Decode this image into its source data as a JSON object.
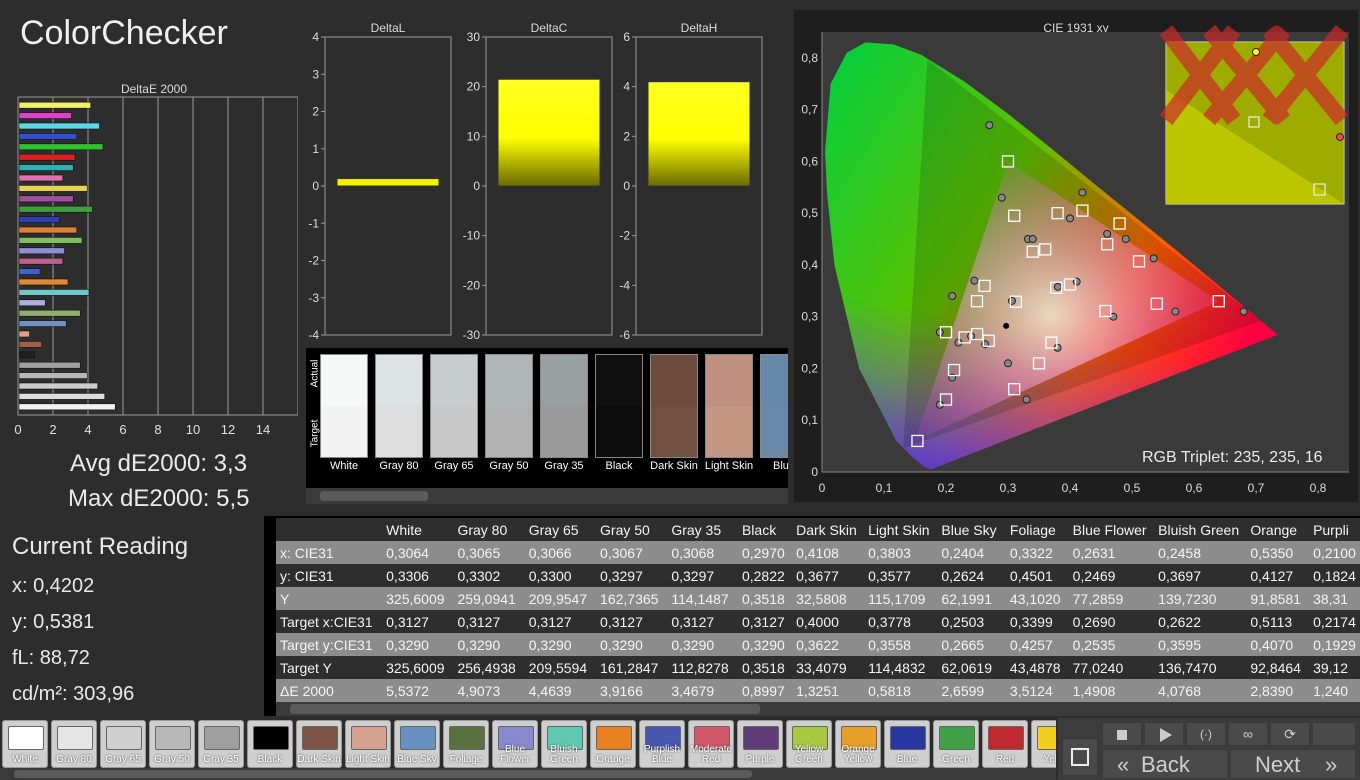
{
  "app": {
    "title": "ColorChecker"
  },
  "deltaE": {
    "title": "DeltaE 2000",
    "ticks": [
      "0",
      "2",
      "4",
      "6",
      "8",
      "10",
      "12",
      "14"
    ],
    "max": 16,
    "bars": [
      {
        "value": 4.1,
        "color": "#f2f26a"
      },
      {
        "value": 3.0,
        "color": "#e040c8"
      },
      {
        "value": 4.6,
        "color": "#58d8e8"
      },
      {
        "value": 3.3,
        "color": "#3050d0"
      },
      {
        "value": 4.8,
        "color": "#30c030"
      },
      {
        "value": 3.2,
        "color": "#e02020"
      },
      {
        "value": 3.1,
        "color": "#30b0b0"
      },
      {
        "value": 2.5,
        "color": "#e070b0"
      },
      {
        "value": 3.9,
        "color": "#e8d050"
      },
      {
        "value": 3.1,
        "color": "#a050a0"
      },
      {
        "value": 4.2,
        "color": "#40a040"
      },
      {
        "value": 2.3,
        "color": "#3040b0"
      },
      {
        "value": 3.3,
        "color": "#e08030"
      },
      {
        "value": 3.6,
        "color": "#80c060"
      },
      {
        "value": 2.6,
        "color": "#9090d0"
      },
      {
        "value": 2.5,
        "color": "#c06090"
      },
      {
        "value": 1.2,
        "color": "#4060d0"
      },
      {
        "value": 2.8,
        "color": "#e08838"
      },
      {
        "value": 4.0,
        "color": "#70c8c8"
      },
      {
        "value": 1.5,
        "color": "#b0b0e0"
      },
      {
        "value": 3.5,
        "color": "#90b070"
      },
      {
        "value": 2.7,
        "color": "#7090c0"
      },
      {
        "value": 0.6,
        "color": "#e0a080"
      },
      {
        "value": 1.3,
        "color": "#a06048"
      },
      {
        "value": 0.9,
        "color": "#202020"
      },
      {
        "value": 3.5,
        "color": "#a0a0a0"
      },
      {
        "value": 3.9,
        "color": "#b8b8b8"
      },
      {
        "value": 4.5,
        "color": "#cccccc"
      },
      {
        "value": 4.9,
        "color": "#dddddd"
      },
      {
        "value": 5.5,
        "color": "#f2f2f2"
      }
    ]
  },
  "avg_label": "Avg dE2000: 3,3",
  "max_label": "Max dE2000: 5,5",
  "current": {
    "title": "Current Reading",
    "x": "x: 0,4202",
    "y": "y: 0,5381",
    "fl": "fL: 88,72",
    "cd": "cd/m²: 303,96"
  },
  "deltas": [
    {
      "title": "DeltaL",
      "ticks": [
        "4",
        "3",
        "2",
        "1",
        "0",
        "-1",
        "-2",
        "-3",
        "-4"
      ],
      "min": -4,
      "max": 4,
      "value": 0.2
    },
    {
      "title": "DeltaC",
      "ticks": [
        "30",
        "20",
        "10",
        "0",
        "-10",
        "-20",
        "-30"
      ],
      "min": -30,
      "max": 30,
      "value": 21.5
    },
    {
      "title": "DeltaH",
      "ticks": [
        "6",
        "4",
        "2",
        "0",
        "-2",
        "-4",
        "-6"
      ],
      "min": -6,
      "max": 6,
      "value": 4.2
    }
  ],
  "swatches": {
    "actual_label": "Actual",
    "target_label": "Target",
    "items": [
      {
        "name": "White",
        "actual": "#f6f8f8",
        "target": "#f3f3f3"
      },
      {
        "name": "Gray 80",
        "actual": "#dde3e2",
        "target": "#dddddd"
      },
      {
        "name": "Gray 65",
        "actual": "#c6cdcc",
        "target": "#c8c8c8"
      },
      {
        "name": "Gray 50",
        "actual": "#b0b6b6",
        "target": "#b2b2b2"
      },
      {
        "name": "Gray 35",
        "actual": "#98a0a0",
        "target": "#9a9a9a"
      },
      {
        "name": "Black",
        "actual": "#101010",
        "target": "#0c0c0c"
      },
      {
        "name": "Dark Skin",
        "actual": "#6d4c3e",
        "target": "#715040"
      },
      {
        "name": "Light Skin",
        "actual": "#c09080",
        "target": "#c49684"
      },
      {
        "name": "Blue",
        "actual": "#6888aa",
        "target": "#6a88a8"
      }
    ]
  },
  "cie": {
    "title": "CIE 1931 xy",
    "x_ticks": [
      "0",
      "0,1",
      "0,2",
      "0,3",
      "0,4",
      "0,5",
      "0,6",
      "0,7",
      "0,8"
    ],
    "y_ticks": [
      "0",
      "0,1",
      "0,2",
      "0,3",
      "0,4",
      "0,5",
      "0,6",
      "0,7",
      "0,8"
    ],
    "triplet": "RGB Triplet: 235, 235, 16",
    "gamut": [
      [
        0.708,
        0.292
      ],
      [
        0.17,
        0.797
      ],
      [
        0.131,
        0.046
      ]
    ],
    "triangle": [
      [
        0.64,
        0.33
      ],
      [
        0.3,
        0.6
      ],
      [
        0.15,
        0.06
      ]
    ],
    "targets": [
      [
        0.3127,
        0.329
      ],
      [
        0.4,
        0.3622
      ],
      [
        0.3778,
        0.3558
      ],
      [
        0.2503,
        0.2665
      ],
      [
        0.3399,
        0.4257
      ],
      [
        0.269,
        0.2535
      ],
      [
        0.2622,
        0.3595
      ],
      [
        0.5113,
        0.407
      ],
      [
        0.213,
        0.197
      ],
      [
        0.457,
        0.311
      ],
      [
        0.23,
        0.26
      ],
      [
        0.42,
        0.505
      ],
      [
        0.54,
        0.325
      ],
      [
        0.46,
        0.44
      ],
      [
        0.154,
        0.06
      ],
      [
        0.3,
        0.6
      ],
      [
        0.64,
        0.33
      ],
      [
        0.31,
        0.495
      ],
      [
        0.37,
        0.25
      ],
      [
        0.2,
        0.14
      ],
      [
        0.36,
        0.43
      ],
      [
        0.48,
        0.48
      ],
      [
        0.35,
        0.21
      ],
      [
        0.25,
        0.33
      ],
      [
        0.2,
        0.27
      ],
      [
        0.31,
        0.16
      ],
      [
        0.38,
        0.5
      ]
    ],
    "actuals": [
      [
        0.3064,
        0.3306
      ],
      [
        0.4108,
        0.3677
      ],
      [
        0.3803,
        0.3577
      ],
      [
        0.2404,
        0.2624
      ],
      [
        0.3322,
        0.4501
      ],
      [
        0.2631,
        0.2469
      ],
      [
        0.2458,
        0.3697
      ],
      [
        0.535,
        0.4127
      ],
      [
        0.21,
        0.1824
      ],
      [
        0.47,
        0.3
      ],
      [
        0.22,
        0.25
      ],
      [
        0.42,
        0.54
      ],
      [
        0.57,
        0.31
      ],
      [
        0.49,
        0.45
      ],
      [
        0.19,
        0.13
      ],
      [
        0.27,
        0.67
      ],
      [
        0.68,
        0.31
      ],
      [
        0.29,
        0.53
      ],
      [
        0.38,
        0.24
      ],
      [
        0.19,
        0.13
      ],
      [
        0.34,
        0.45
      ],
      [
        0.46,
        0.46
      ],
      [
        0.33,
        0.14
      ],
      [
        0.21,
        0.34
      ],
      [
        0.19,
        0.27
      ],
      [
        0.3,
        0.21
      ],
      [
        0.4,
        0.49
      ]
    ],
    "black_point": [
      0.297,
      0.2822
    ],
    "inset_x_marks": [
      [
        0.42,
        0.538
      ]
    ]
  },
  "table": {
    "headers": [
      "",
      "White",
      "Gray 80",
      "Gray 65",
      "Gray 50",
      "Gray 35",
      "Black",
      "Dark Skin",
      "Light Skin",
      "Blue Sky",
      "Foliage",
      "Blue Flower",
      "Bluish Green",
      "Orange",
      "Purpli"
    ],
    "rows": [
      [
        "x: CIE31",
        "0,3064",
        "0,3065",
        "0,3066",
        "0,3067",
        "0,3068",
        "0,2970",
        "0,4108",
        "0,3803",
        "0,2404",
        "0,3322",
        "0,2631",
        "0,2458",
        "0,5350",
        "0,2100"
      ],
      [
        "y: CIE31",
        "0,3306",
        "0,3302",
        "0,3300",
        "0,3297",
        "0,3297",
        "0,2822",
        "0,3677",
        "0,3577",
        "0,2624",
        "0,4501",
        "0,2469",
        "0,3697",
        "0,4127",
        "0,1824"
      ],
      [
        "Y",
        "325,6009",
        "259,0941",
        "209,9547",
        "162,7365",
        "114,1487",
        "0,3518",
        "32,5808",
        "115,1709",
        "62,1991",
        "43,1020",
        "77,2859",
        "139,7230",
        "91,8581",
        "38,31"
      ],
      [
        "Target x:CIE31",
        "0,3127",
        "0,3127",
        "0,3127",
        "0,3127",
        "0,3127",
        "0,3127",
        "0,4000",
        "0,3778",
        "0,2503",
        "0,3399",
        "0,2690",
        "0,2622",
        "0,5113",
        "0,2174"
      ],
      [
        "Target y:CIE31",
        "0,3290",
        "0,3290",
        "0,3290",
        "0,3290",
        "0,3290",
        "0,3290",
        "0,3622",
        "0,3558",
        "0,2665",
        "0,4257",
        "0,2535",
        "0,3595",
        "0,4070",
        "0,1929"
      ],
      [
        "Target Y",
        "325,6009",
        "256,4938",
        "209,5594",
        "161,2847",
        "112,8278",
        "0,3518",
        "33,4079",
        "114,4832",
        "62,0619",
        "43,4878",
        "77,0240",
        "136,7470",
        "92,8464",
        "39,12"
      ],
      [
        "ΔE 2000",
        "5,5372",
        "4,9073",
        "4,4639",
        "3,9166",
        "3,4679",
        "0,8997",
        "1,3251",
        "0,5818",
        "2,6599",
        "3,5124",
        "1,4908",
        "4,0768",
        "2,8390",
        "1,240"
      ]
    ]
  },
  "bottom_buttons": [
    {
      "label": "White",
      "color": "#ffffff"
    },
    {
      "label": "Gray 80",
      "color": "#e6e6e6"
    },
    {
      "label": "Gray 65",
      "color": "#cfcfcf"
    },
    {
      "label": "Gray 50",
      "color": "#b8b8b8"
    },
    {
      "label": "Gray 35",
      "color": "#9f9f9f"
    },
    {
      "label": "Black",
      "color": "#000000"
    },
    {
      "label": "Dark Skin",
      "color": "#7a5545"
    },
    {
      "label": "Light Skin",
      "color": "#d4a28e"
    },
    {
      "label": "Blue Sky",
      "color": "#6890c0"
    },
    {
      "label": "Foliage",
      "color": "#5a7040"
    },
    {
      "label": "Blue Flower",
      "color": "#8888cc"
    },
    {
      "label": "Bluish Green",
      "color": "#60c8b0"
    },
    {
      "label": "Orange",
      "color": "#e88020"
    },
    {
      "label": "Purplish Blue",
      "color": "#4858b0"
    },
    {
      "label": "Moderate Red",
      "color": "#d05868"
    },
    {
      "label": "Purple",
      "color": "#603c78"
    },
    {
      "label": "Yellow Green",
      "color": "#a8c840"
    },
    {
      "label": "Orange Yellow",
      "color": "#e8a028"
    },
    {
      "label": "Blue",
      "color": "#2838a0"
    },
    {
      "label": "Green",
      "color": "#40a048"
    },
    {
      "label": "Red",
      "color": "#c02830"
    },
    {
      "label": "Yello",
      "color": "#f0d020"
    }
  ],
  "nav": {
    "back": "Back",
    "next": "Next",
    "back_arrows": "«",
    "next_arrows": "»"
  }
}
